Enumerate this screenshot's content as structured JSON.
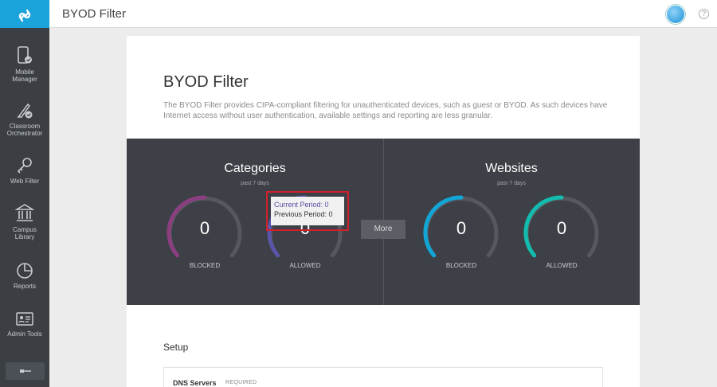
{
  "header": {
    "title": "BYOD Filter"
  },
  "sidebar": {
    "items": [
      {
        "label1": "Mobile",
        "label2": "Manager",
        "icon": "mobile-manager-icon"
      },
      {
        "label1": "Classroom",
        "label2": "Orchestrator",
        "icon": "classroom-orchestrator-icon"
      },
      {
        "label1": "Web Filter",
        "label2": "",
        "icon": "key-icon"
      },
      {
        "label1": "Campus",
        "label2": "Library",
        "icon": "library-icon"
      },
      {
        "label1": "Reports",
        "label2": "",
        "icon": "pie-chart-icon"
      },
      {
        "label1": "Admin Tools",
        "label2": "",
        "icon": "admin-tools-icon"
      }
    ]
  },
  "main": {
    "title": "BYOD Filter",
    "description": "The BYOD Filter provides CIPA-compliant filtering for unauthenticated devices, such as guest or BYOD. As such devices have Internet access without user authentication, available settings and reporting are less granular.",
    "categories": {
      "title": "Categories",
      "period": "past 7 days",
      "blocked": {
        "value": "0",
        "label": "BLOCKED",
        "color": "#8b3f80"
      },
      "allowed": {
        "value": "0",
        "label": "ALLOWED",
        "color": "#5b55a8"
      }
    },
    "more_label": "More",
    "websites": {
      "title": "Websites",
      "period": "past 7 days",
      "blocked": {
        "value": "0",
        "label": "BLOCKED",
        "color": "#11a6d6"
      },
      "allowed": {
        "value": "0",
        "label": "ALLOWED",
        "color": "#12bdb0"
      }
    },
    "tooltip": {
      "current": "Current Period: 0",
      "previous": "Previous Period: 0"
    },
    "setup": {
      "title": "Setup",
      "dns_label": "DNS Servers",
      "dns_required": "REQUIRED"
    }
  }
}
